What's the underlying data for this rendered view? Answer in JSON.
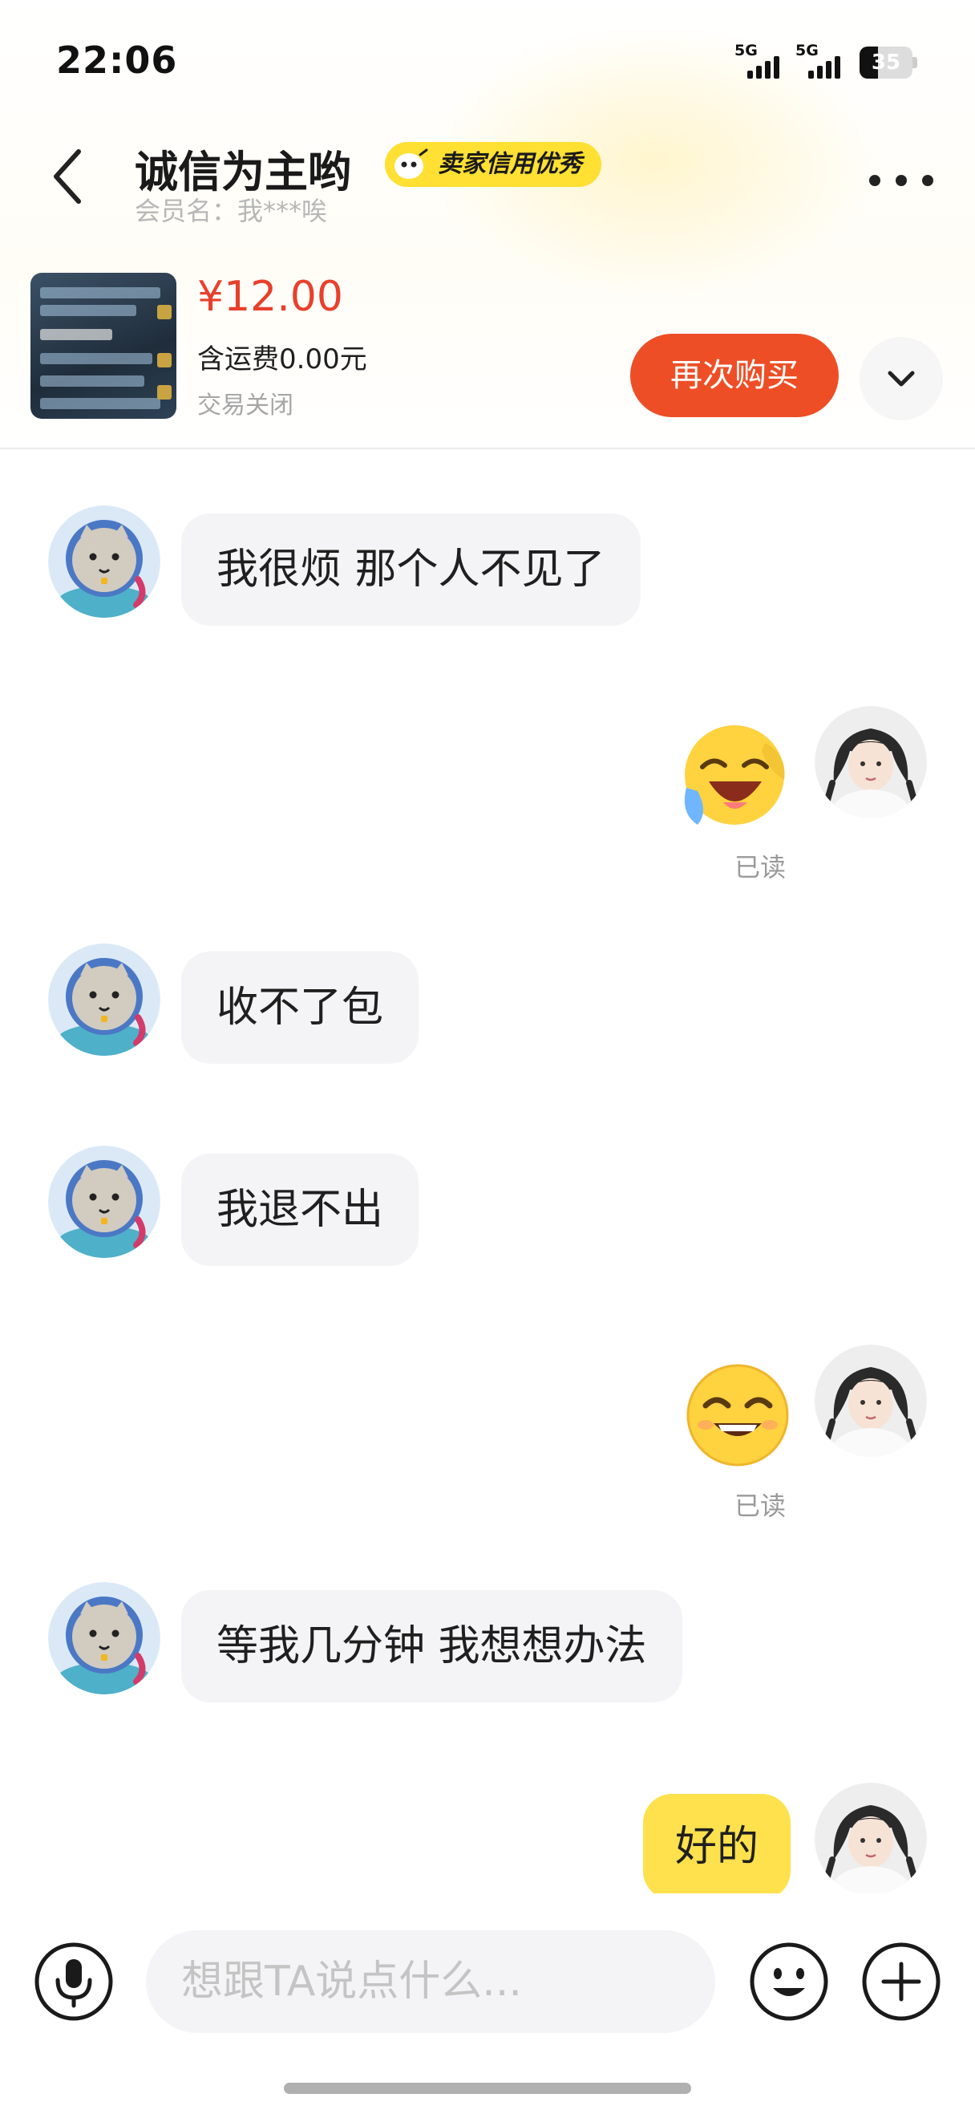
{
  "status_bar": {
    "time": "22:06",
    "network_1": "5G",
    "network_2": "5G",
    "battery_level": "35",
    "battery_fraction": 0.35
  },
  "header": {
    "shop_name": "诚信为主哟",
    "badge": "卖家信用优秀",
    "member_name": "会员名：我***唉"
  },
  "product": {
    "price": "¥12.00",
    "shipping": "含运费0.00元",
    "status": "交易关闭",
    "rebuy_label": "再次购买"
  },
  "messages": [
    {
      "from": "seller",
      "type": "text",
      "text": "我很烦 那个人不见了"
    },
    {
      "from": "me",
      "type": "emoji",
      "emoji": "laughing-tears-emoji",
      "read": "已读"
    },
    {
      "from": "seller",
      "type": "text",
      "text": "收不了包"
    },
    {
      "from": "seller",
      "type": "text",
      "text": "我退不出"
    },
    {
      "from": "me",
      "type": "emoji",
      "emoji": "grinning-emoji",
      "read": "已读"
    },
    {
      "from": "seller",
      "type": "text",
      "text": "等我几分钟 我想想办法"
    },
    {
      "from": "me",
      "type": "text",
      "text": "好的"
    }
  ],
  "input": {
    "placeholder": "想跟TA说点什么..."
  },
  "colors": {
    "accent_yellow": "#ffe14d",
    "rebuy_orange": "#ee4e26",
    "price_red": "#e8402c"
  }
}
